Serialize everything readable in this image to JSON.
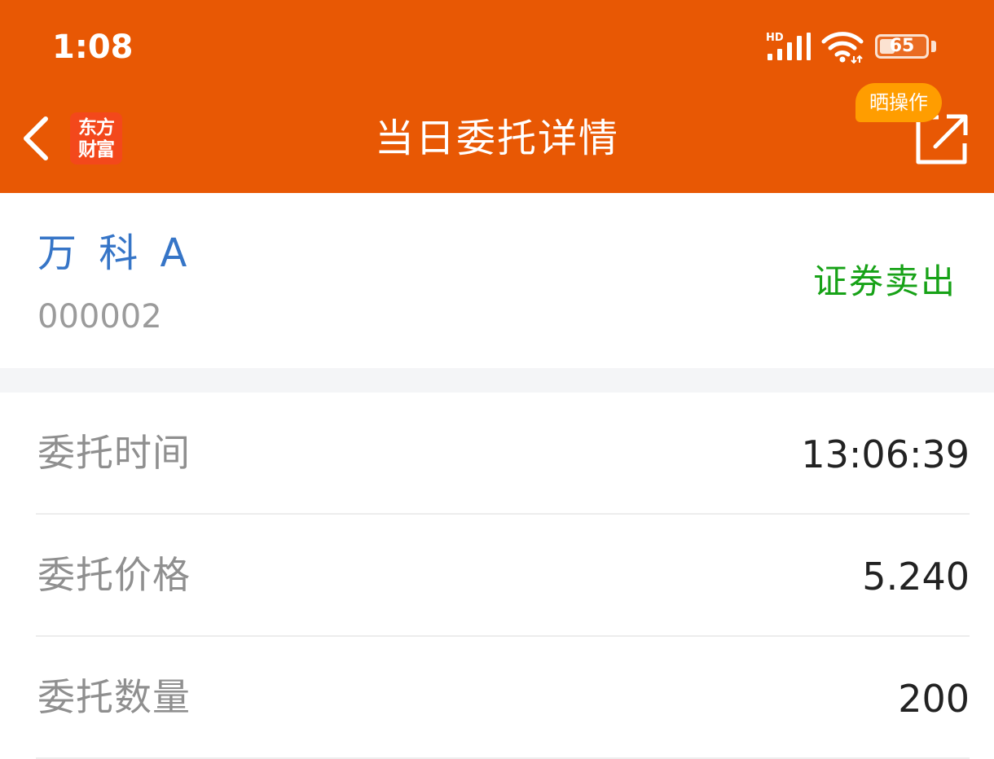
{
  "status_bar": {
    "time": "1:08",
    "network_label": "HD",
    "battery_percent": "65",
    "battery_level": 0.65
  },
  "nav": {
    "title": "当日委托详情",
    "logo_line1": "东方",
    "logo_line2": "财富",
    "share_badge": "晒操作"
  },
  "stock": {
    "name": "万 科 A",
    "code": "000002",
    "trade_type": "证券卖出"
  },
  "details": [
    {
      "label": "委托时间",
      "value": "13:06:39"
    },
    {
      "label": "委托价格",
      "value": "5.240"
    },
    {
      "label": "委托数量",
      "value": "200"
    }
  ],
  "colors": {
    "brand": "#e85804",
    "badge": "#ff9d00",
    "stock_name": "#3675c7",
    "sell": "#17a217"
  }
}
